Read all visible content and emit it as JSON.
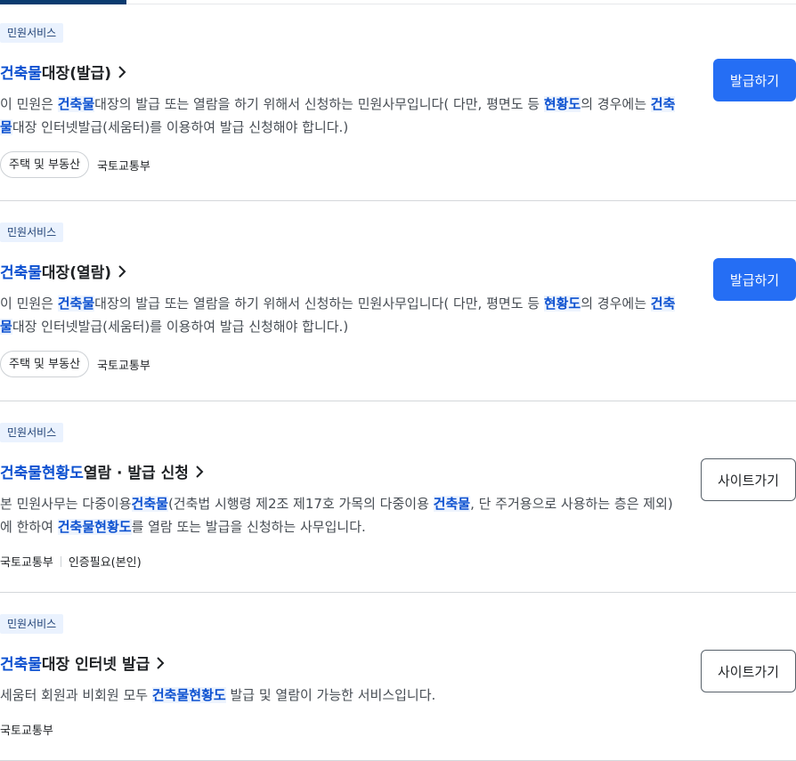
{
  "results": [
    {
      "badge": "민원서비스",
      "title": {
        "hl": "건축물",
        "rest": "대장(발급)"
      },
      "desc": {
        "t1": "이 민원은 ",
        "h1": "건축물",
        "t2": "대장의 발급 또는 열람을 하기 위해서 신청하는 민원사무입니다( 다만, 평면도 등 ",
        "h2": "현황도",
        "t3": "의 경우에는 ",
        "h3": "건축물",
        "t4": "대장 인터넷발급(세움터)를 이용하여 발급 신청해야 합니다.)"
      },
      "meta": {
        "tag": "주택 및 부동산",
        "agency": "국토교통부"
      },
      "action": "발급하기"
    },
    {
      "badge": "민원서비스",
      "title": {
        "hl": "건축물",
        "rest": "대장(열람)"
      },
      "desc": {
        "t1": "이 민원은 ",
        "h1": "건축물",
        "t2": "대장의 발급 또는 열람을 하기 위해서 신청하는 민원사무입니다( 다만, 평면도 등 ",
        "h2": "현황도",
        "t3": "의 경우에는 ",
        "h3": "건축물",
        "t4": "대장 인터넷발급(세움터)를 이용하여 발급 신청해야 합니다.)"
      },
      "meta": {
        "tag": "주택 및 부동산",
        "agency": "국토교통부"
      },
      "action": "발급하기"
    },
    {
      "badge": "민원서비스",
      "title": {
        "hl": "건축물현황도",
        "rest": " 열람 · 발급 신청"
      },
      "desc": {
        "t1": "본 민원사무는 다중이용",
        "h1": "건축물",
        "t2": "(건축법 시행령 제2조 제17호 가목의 다중이용 ",
        "h2": "건축물",
        "t3": ", 단 주거용으로 사용하는 층은 제외)에 한하여 ",
        "h3": "건축물현황도",
        "t4": "를 열람 또는 발급을 신청하는 사무입니다."
      },
      "meta": {
        "agency": "국토교통부",
        "auth": "인증필요(본인)"
      },
      "action": "사이트가기"
    },
    {
      "badge": "민원서비스",
      "title": {
        "hl": "건축물",
        "rest": "대장 인터넷 발급"
      },
      "desc": {
        "t1": "세움터 회원과 비회원 모두 ",
        "h1": "건축물현황도",
        "t2": " 발급 및 열람이 가능한 서비스입니다."
      },
      "meta": {
        "agency": "국토교통부"
      },
      "action": "사이트가기"
    }
  ]
}
